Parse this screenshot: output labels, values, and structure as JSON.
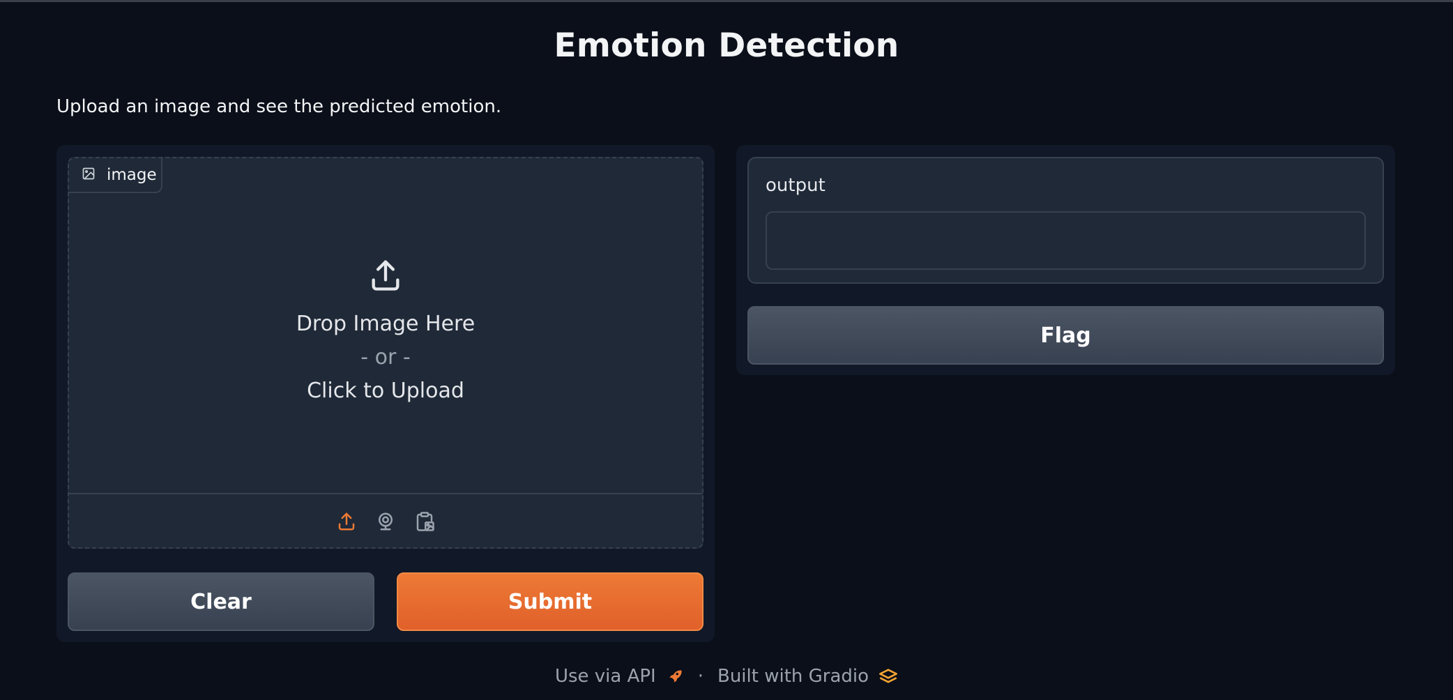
{
  "app": {
    "title": "Emotion Detection",
    "description": "Upload an image and see the predicted emotion."
  },
  "input": {
    "label": "image",
    "drop_text": "Drop Image Here",
    "or_text": "- or -",
    "click_text": "Click to Upload",
    "sources": [
      "upload-icon",
      "webcam-icon",
      "clipboard-icon"
    ]
  },
  "buttons": {
    "clear": "Clear",
    "submit": "Submit",
    "flag": "Flag"
  },
  "output": {
    "label": "output",
    "value": ""
  },
  "footer": {
    "api": "Use via API",
    "separator": "·",
    "built": "Built with Gradio"
  },
  "colors": {
    "background": "#0b0f19",
    "panel": "#111827",
    "block": "#1f2937",
    "border": "#374151",
    "accent": "#ed7a35",
    "secondary_button": "#4b5563"
  }
}
